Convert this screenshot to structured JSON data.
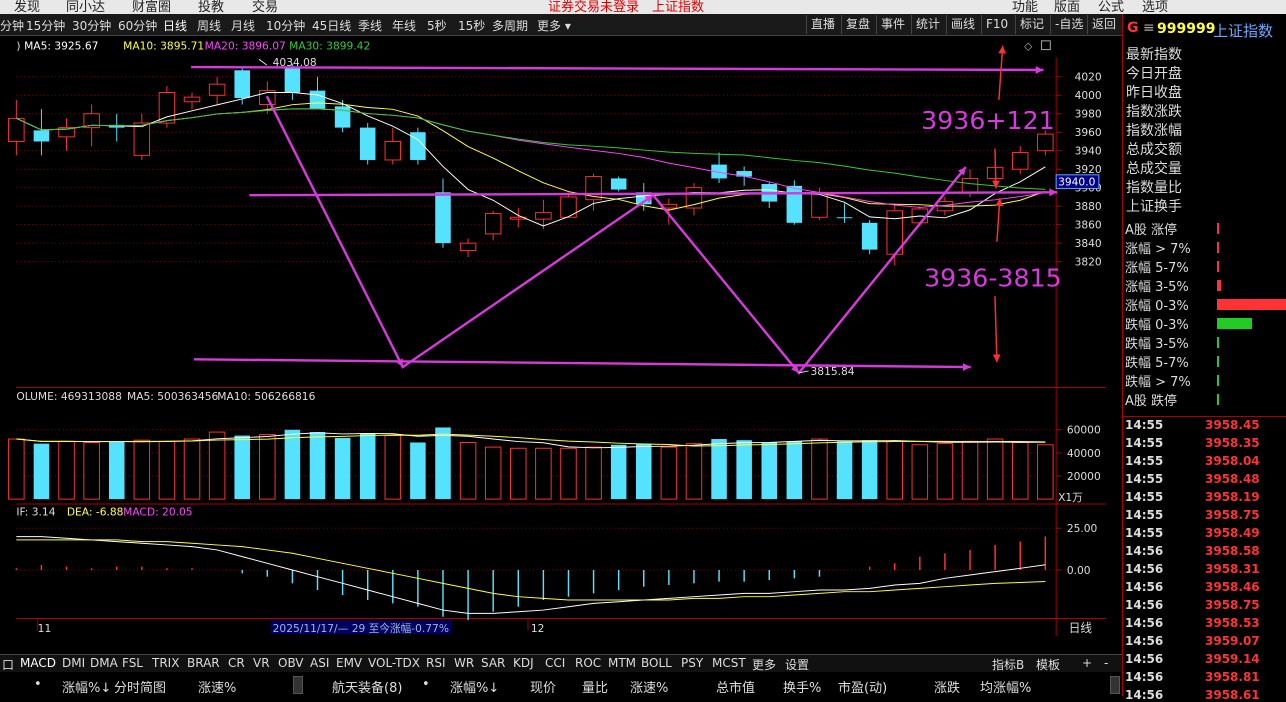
{
  "top_menu": {
    "items": [
      "发现",
      "同小达",
      "财富圈",
      "投教",
      "交易"
    ],
    "warning": "证券交易未登录　上证指数",
    "right_items": [
      "功能",
      "版面",
      "公式",
      "选项"
    ]
  },
  "period_bar": {
    "periods": [
      "分钟",
      "15分钟",
      "30分钟",
      "60分钟",
      "日线",
      "周线",
      "月线",
      "10分钟",
      "45日线",
      "季线",
      "年线",
      "5秒",
      "15秒",
      "多周期",
      "更多 ▾"
    ],
    "active": "日线",
    "tools": [
      "直播",
      "复盘",
      "事件",
      "统计",
      "画线",
      "F10",
      "标记",
      "-自选",
      "返回"
    ]
  },
  "main_legend": {
    "prefix": ")",
    "ma5": "MA5: 3925.67",
    "ma10": "MA10: 3895.71",
    "ma20": "MA20: 3896.07",
    "ma30": "MA30: 3899.42"
  },
  "price_axis": [
    "4020",
    "4000",
    "3980",
    "3960",
    "3940",
    "3920",
    "3900",
    "3880",
    "3860",
    "3840",
    "3820"
  ],
  "price_axis_highlight": "3940.0",
  "annotations": {
    "high_label": "4034.08",
    "low_label": "3815.84",
    "target_up": "3936+121",
    "target_down": "3936-3815"
  },
  "volume_legend": {
    "volume": "OLUME: 469313088",
    "ma5": "MA5: 500363456",
    "ma10": "MA10: 506266816"
  },
  "volume_axis": [
    "60000",
    "40000",
    "20000"
  ],
  "volume_unit": "X1万",
  "macd_legend": {
    "dif": "IF: 3.14",
    "dea": "DEA: -6.88",
    "macd": "MACD: 20.05"
  },
  "macd_axis": [
    "25.00",
    "0.00"
  ],
  "time_axis": {
    "month1": "11",
    "month2": "12",
    "range_info": "2025/11/17/— 29 至今涨幅-0.77%",
    "period_label": "日线"
  },
  "indicator_tabs": {
    "items": [
      "口",
      "MACD",
      "DMI",
      "DMA",
      "FSL",
      "TRIX",
      "BRAR",
      "CR",
      "VR",
      "OBV",
      "ASI",
      "EMV",
      "VOL-TDX",
      "RSI",
      "WR",
      "SAR",
      "KDJ",
      "CCI",
      "ROC",
      "MTM",
      "BOLL",
      "PSY",
      "MCST",
      "更多",
      "设置"
    ],
    "active": "MACD",
    "right": [
      "指标B",
      "模板",
      "+",
      "-"
    ]
  },
  "column_bar": {
    "left": [
      "•",
      "涨幅%↓",
      "分时简图",
      "涨速%"
    ],
    "right": [
      "航天装备(8)",
      "•",
      "涨幅%↓",
      "现价",
      "量比",
      "涨速%",
      "总市值",
      "换手%",
      "市盈(动)",
      "涨跌",
      "均涨幅%"
    ]
  },
  "right_panel": {
    "code": "999999",
    "name": "上证指数",
    "stats": [
      "最新指数",
      "今日开盘",
      "昨日收盘",
      "指数涨跌",
      "指数涨幅",
      "总成交额",
      "总成交量",
      "指数量比",
      "上证换手"
    ],
    "buckets": [
      {
        "label": "A股 涨停",
        "value": 0.02,
        "color": "#ff3333"
      },
      {
        "label": "涨幅 > 7%",
        "value": 0.02,
        "color": "#ff3333"
      },
      {
        "label": "涨幅 5-7%",
        "value": 0.03,
        "color": "#ff3333"
      },
      {
        "label": "涨幅 3-5%",
        "value": 0.06,
        "color": "#ff3333"
      },
      {
        "label": "涨幅 0-3%",
        "value": 1.0,
        "color": "#ff3333"
      },
      {
        "label": "跌幅 0-3%",
        "value": 0.5,
        "color": "#22cc22"
      },
      {
        "label": "跌幅 3-5%",
        "value": 0.02,
        "color": "#22cc22"
      },
      {
        "label": "跌幅 5-7%",
        "value": 0.01,
        "color": "#22cc22"
      },
      {
        "label": "跌幅 > 7%",
        "value": 0.01,
        "color": "#22cc22"
      },
      {
        "label": "A股 跌停",
        "value": 0.01,
        "color": "#22cc22"
      }
    ],
    "ticks": [
      {
        "time": "14:55",
        "price": "3958.45"
      },
      {
        "time": "14:55",
        "price": "3958.35"
      },
      {
        "time": "14:55",
        "price": "3958.04"
      },
      {
        "time": "14:55",
        "price": "3958.48"
      },
      {
        "time": "14:55",
        "price": "3958.19"
      },
      {
        "time": "14:55",
        "price": "3958.75"
      },
      {
        "time": "14:55",
        "price": "3958.49"
      },
      {
        "time": "14:56",
        "price": "3958.58"
      },
      {
        "time": "14:56",
        "price": "3958.31"
      },
      {
        "time": "14:56",
        "price": "3958.46"
      },
      {
        "time": "14:56",
        "price": "3958.75"
      },
      {
        "time": "14:56",
        "price": "3958.53"
      },
      {
        "time": "14:56",
        "price": "3959.07"
      },
      {
        "time": "14:56",
        "price": "3959.14"
      },
      {
        "time": "14:56",
        "price": "3958.81"
      },
      {
        "time": "14:56",
        "price": "3958.61"
      }
    ]
  },
  "candles": [
    {
      "o": 3950,
      "h": 3995,
      "l": 3935,
      "c": 3975
    },
    {
      "o": 3962,
      "h": 3985,
      "l": 3935,
      "c": 3950
    },
    {
      "o": 3955,
      "h": 3975,
      "l": 3940,
      "c": 3965
    },
    {
      "o": 3965,
      "h": 3990,
      "l": 3945,
      "c": 3980
    },
    {
      "o": 3968,
      "h": 3980,
      "l": 3950,
      "c": 3965
    },
    {
      "o": 3935,
      "h": 3980,
      "l": 3930,
      "c": 3970
    },
    {
      "o": 3970,
      "h": 4010,
      "l": 3965,
      "c": 4003
    },
    {
      "o": 3993,
      "h": 4003,
      "l": 3985,
      "c": 3998
    },
    {
      "o": 4000,
      "h": 4020,
      "l": 3990,
      "c": 4012
    },
    {
      "o": 4027,
      "h": 4030,
      "l": 3990,
      "c": 3997
    },
    {
      "o": 3990,
      "h": 4015,
      "l": 3980,
      "c": 4005
    },
    {
      "o": 4030,
      "h": 4034.08,
      "l": 3995,
      "c": 4003
    },
    {
      "o": 4005,
      "h": 4020,
      "l": 3990,
      "c": 3985
    },
    {
      "o": 3988,
      "h": 3995,
      "l": 3960,
      "c": 3965
    },
    {
      "o": 3965,
      "h": 3970,
      "l": 3925,
      "c": 3930
    },
    {
      "o": 3930,
      "h": 3965,
      "l": 3925,
      "c": 3950
    },
    {
      "o": 3960,
      "h": 3965,
      "l": 3925,
      "c": 3930
    },
    {
      "o": 3895,
      "h": 3910,
      "l": 3835,
      "c": 3840
    },
    {
      "o": 3832,
      "h": 3845,
      "l": 3825,
      "c": 3840
    },
    {
      "o": 3850,
      "h": 3875,
      "l": 3843,
      "c": 3872
    },
    {
      "o": 3866,
      "h": 3878,
      "l": 3857,
      "c": 3868
    },
    {
      "o": 3866,
      "h": 3887,
      "l": 3855,
      "c": 3873
    },
    {
      "o": 3868,
      "h": 3895,
      "l": 3868,
      "c": 3890
    },
    {
      "o": 3887,
      "h": 3915,
      "l": 3875,
      "c": 3912
    },
    {
      "o": 3910,
      "h": 3912,
      "l": 3896,
      "c": 3898
    },
    {
      "o": 3895,
      "h": 3905,
      "l": 3875,
      "c": 3882
    },
    {
      "o": 3878,
      "h": 3888,
      "l": 3860,
      "c": 3882
    },
    {
      "o": 3878,
      "h": 3905,
      "l": 3870,
      "c": 3900
    },
    {
      "o": 3925,
      "h": 3938,
      "l": 3905,
      "c": 3910
    },
    {
      "o": 3918,
      "h": 3923,
      "l": 3902,
      "c": 3912
    },
    {
      "o": 3904,
      "h": 3906,
      "l": 3878,
      "c": 3885
    },
    {
      "o": 3902,
      "h": 3908,
      "l": 3860,
      "c": 3862
    },
    {
      "o": 3868,
      "h": 3900,
      "l": 3865,
      "c": 3895
    },
    {
      "o": 3868,
      "h": 3883,
      "l": 3862,
      "c": 3867
    },
    {
      "o": 3862,
      "h": 3865,
      "l": 3828,
      "c": 3833
    },
    {
      "o": 3828,
      "h": 3882,
      "l": 3815.84,
      "c": 3875
    },
    {
      "o": 3862,
      "h": 3880,
      "l": 3858,
      "c": 3877
    },
    {
      "o": 3875,
      "h": 3890,
      "l": 3870,
      "c": 3885
    },
    {
      "o": 3895,
      "h": 3920,
      "l": 3890,
      "c": 3910
    },
    {
      "o": 3910,
      "h": 3925,
      "l": 3905,
      "c": 3922
    },
    {
      "o": 3920,
      "h": 3945,
      "l": 3915,
      "c": 3938
    },
    {
      "o": 3940,
      "h": 3962,
      "l": 3935,
      "c": 3958
    }
  ],
  "volumes": [
    52000,
    48000,
    50000,
    49000,
    50000,
    51000,
    50000,
    52000,
    58000,
    55000,
    56000,
    60000,
    58000,
    53000,
    57000,
    55000,
    49000,
    62000,
    49000,
    45000,
    44000,
    44000,
    44000,
    45000,
    47000,
    48000,
    45000,
    48000,
    52000,
    51000,
    49000,
    50000,
    52000,
    50000,
    51000,
    50000,
    47000,
    48000,
    50000,
    52000,
    49000,
    47000
  ],
  "macd_values": [
    1,
    3,
    2,
    1,
    2,
    2,
    1,
    1,
    0,
    -2,
    -4,
    -8,
    -12,
    -15,
    -18,
    -20,
    -22,
    -28,
    -30,
    -25,
    -22,
    -18,
    -16,
    -14,
    -12,
    -10,
    -9,
    -8,
    -7,
    -7,
    -6,
    -5,
    -4,
    0,
    2,
    4,
    8,
    10,
    12,
    15,
    17,
    20.05
  ],
  "dif_values": [
    20,
    20,
    19,
    18,
    17,
    16,
    15,
    14,
    12,
    8,
    4,
    0,
    -4,
    -8,
    -12,
    -16,
    -20,
    -24,
    -26,
    -26,
    -25,
    -24,
    -22,
    -20,
    -19,
    -18,
    -17,
    -16,
    -15,
    -14,
    -14,
    -13,
    -12,
    -12,
    -11,
    -9,
    -8,
    -5,
    -3,
    -1,
    1,
    3.14
  ],
  "dea_values": [
    18,
    18,
    18,
    18,
    18,
    17,
    17,
    16,
    15,
    14,
    12,
    10,
    7,
    4,
    1,
    -2,
    -5,
    -8,
    -11,
    -14,
    -16,
    -17,
    -18,
    -18,
    -18,
    -18,
    -18,
    -17,
    -17,
    -16,
    -16,
    -15,
    -14,
    -13,
    -13,
    -12,
    -11,
    -10,
    -9,
    -8,
    -7.5,
    -6.88
  ],
  "colors": {
    "up": "#ff3333",
    "down": "#55e2ff",
    "ma5": "#ffffff",
    "ma10": "#ffff44",
    "ma20": "#ff44ff",
    "ma30": "#33cc33",
    "annot": "#d53adb",
    "arrow": "#ff3030",
    "grid": "#8a0000"
  }
}
